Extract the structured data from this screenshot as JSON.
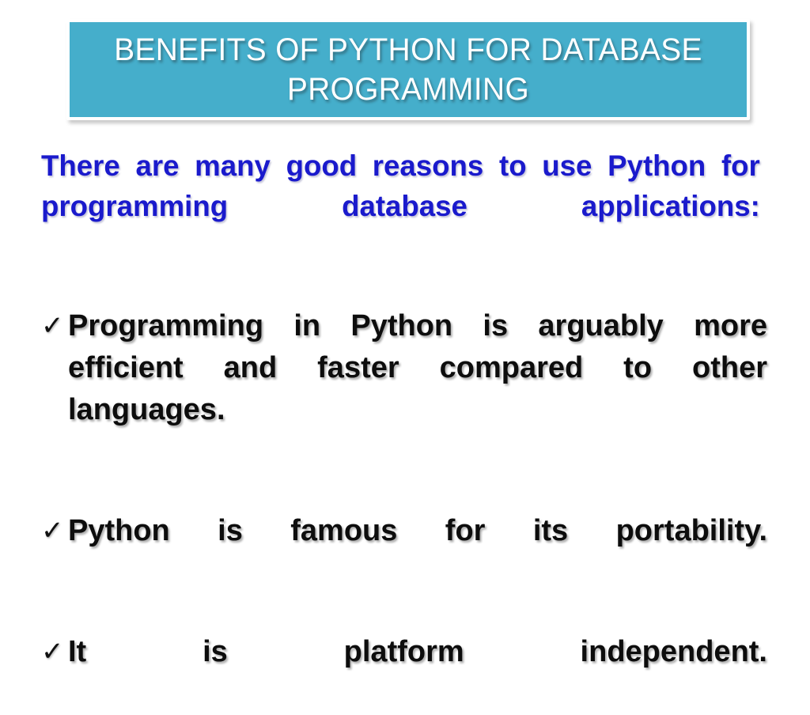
{
  "slide": {
    "background_color": "#ffffff",
    "title": {
      "text": "BENEFITS OF PYTHON FOR DATABASE PROGRAMMING",
      "banner_color": "#45aecb",
      "text_color": "#ffffff",
      "border_color": "#ffffff"
    },
    "lead": {
      "text": "There are many good reasons to use Python for programming database applications:",
      "color": "#1a1acc"
    },
    "bullets": {
      "marker_icon": "check-mark-icon",
      "marker_glyph": "✓",
      "text_color": "#0d0d0d",
      "items": [
        {
          "text": "Programming in Python is arguably more efficient and faster compared to other languages."
        },
        {
          "text": "Python is famous for its portability."
        },
        {
          "text": "It is platform independent."
        }
      ]
    }
  }
}
